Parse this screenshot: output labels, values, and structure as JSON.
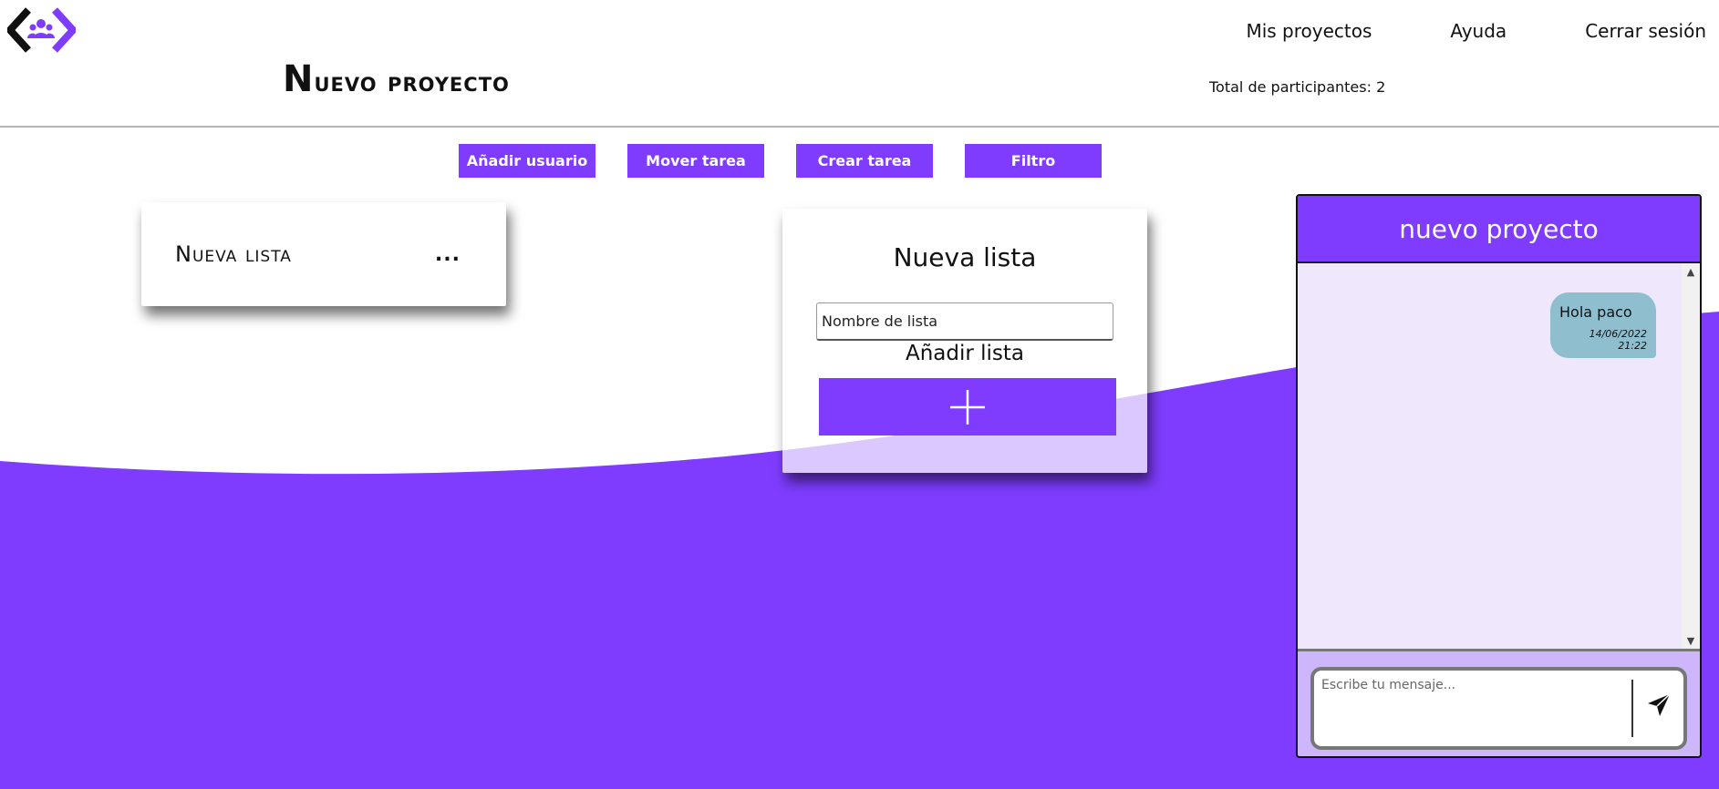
{
  "header": {
    "nav": {
      "projects": "Mis proyectos",
      "help": "Ayuda",
      "logout": "Cerrar sesión"
    },
    "title": "Nuevo proyecto",
    "participants": "Total de participantes: 2"
  },
  "toolbar": {
    "add_user": "Añadir usuario",
    "move_task": "Mover tarea",
    "create_task": "Crear tarea",
    "filter": "Filtro"
  },
  "list": {
    "title": "Nueva lista",
    "menu": "..."
  },
  "new_list_form": {
    "heading": "Nueva lista",
    "input_placeholder": "Nombre de lista",
    "add_label": "Añadir lista"
  },
  "chat": {
    "title": "nuevo proyecto",
    "messages": [
      {
        "text": "Hola paco",
        "time": "14/06/2022 21:22"
      }
    ],
    "input_placeholder": "Escribe tu mensaje..."
  },
  "colors": {
    "accent": "#7f3cff",
    "bubble": "#8fbfce",
    "chat_bg": "#efe8fd"
  }
}
